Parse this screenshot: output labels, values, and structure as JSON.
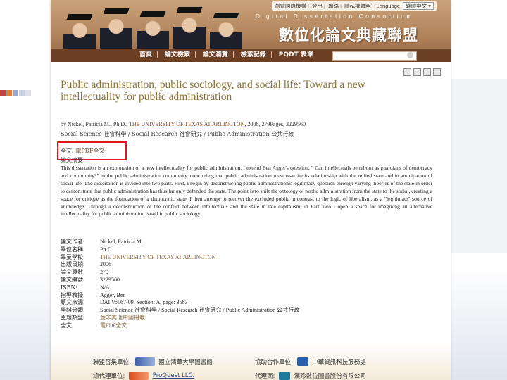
{
  "header": {
    "top_links": [
      "瀏覽國際機構",
      "登出",
      "聯絡",
      "隱私權聲明"
    ],
    "language_label": "Language",
    "language_value": "繁體中文",
    "consortium": "Digital Dissertation Consortium",
    "title_ch": "數位化論文典藏聯盟"
  },
  "nav": {
    "items": [
      "首頁",
      "論文檢索",
      "論文瀏覽",
      "檢索記錄",
      "PQDT 表單"
    ]
  },
  "record": {
    "title": "Public administration, public sociology, and social life: Toward a new intellectuality for public administration",
    "by": "by Nickel, Patricia M., Ph.D.,",
    "school_link": "THE UNIVERSITY OF TEXAS AT ARLINGTON",
    "by_rest": ", 2006, 279Pages, 3229560",
    "subjects": "Social Science 社會科學 / Social Research 社會研究 / Public Administration 公共行政",
    "fulltext_label": "全文:",
    "fulltext_link": "電PDF全文",
    "abstract_label": "論文摘要:",
    "abstract": "This dissertation is an exploration of a new intellectuality for public administration. I extend Ben Agger's question, \" Can intellectuals be reborn as guardians of democracy and community?\" to the public administration community, concluding that public administration must re-write its relationship with the reified state and in anticipation of social life. The dissertation is divided into two parts. First, I begin by deconstructing public administration's legitimacy question through varying theories of the state in order to demonstrate that public administration has thus far only defended the state. The point is to shift the ontology of public administration from the state to the social, creating a space for critique as the foundation of a democratic state. I then attempt to recover the excluded public in contrast to the logic of liberalism, as a \"legitimate\" source of knowledge. Through a deconstruction of the conflict between intellectuals and the state in late capitalism, in Part Two I open a space for imagining an alternative intellectuality for public administration based in public sociology."
  },
  "meta": [
    {
      "label": "論文作者:",
      "value": "Nickel, Patricia M."
    },
    {
      "label": "畢位名稱:",
      "value": "Ph.D."
    },
    {
      "label": "畢業學校:",
      "value": "THE UNIVERSITY OF TEXAS AT ARLINGTON"
    },
    {
      "label": "出版日期:",
      "value": "2006"
    },
    {
      "label": "論文頁數:",
      "value": "279"
    },
    {
      "label": "論文編號:",
      "value": "3229560"
    },
    {
      "label": "ISBN:",
      "value": "N/A"
    },
    {
      "label": "指導教授:",
      "value": "Agger, Ben"
    },
    {
      "label": "原文來源:",
      "value": "DAI Vol.67-09, Section: A, page: 3583"
    },
    {
      "label": "學科分類:",
      "value": "Social Science 社會科學 / Social Research 社會研究 / Public Administration 公共行政"
    },
    {
      "label": "主題類型:",
      "value": "並非其他中國冊載"
    },
    {
      "label": "全文:",
      "value": "電PDF全文"
    }
  ],
  "footer": {
    "row1_left_label": "聯盟召集單位:",
    "row1_left_org": "國立清華大學圖書館",
    "row1_right_label": "協助合作單位:",
    "row1_right_org": "中華資訊科技服務處",
    "row2_left_label": "總代理單位:",
    "row2_left_org": "ProQuest LLC.",
    "row2_right_label": "代理商:",
    "row2_right_org": "漢珍數位圖書股份有限公司"
  },
  "colors": {
    "accent_title": "#8a7333",
    "nav_bar": "#6b3f24",
    "highlight_box": "#e4141b"
  }
}
